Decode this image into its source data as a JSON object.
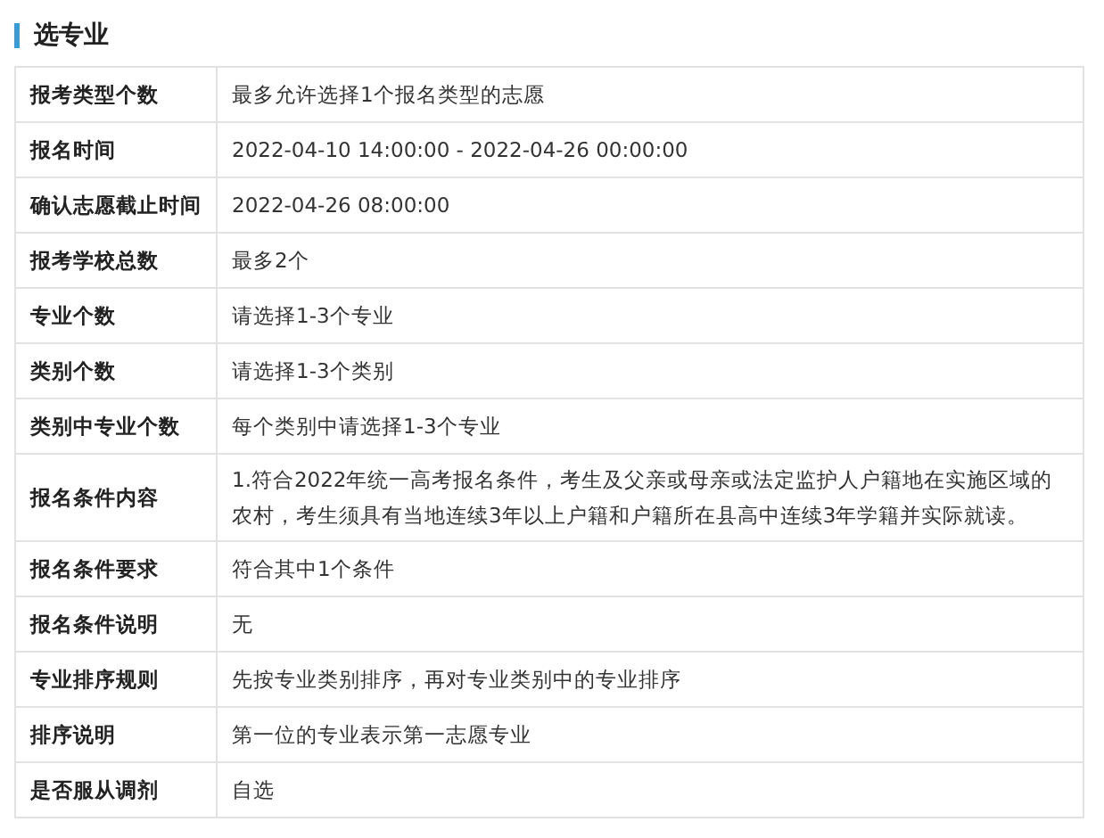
{
  "section": {
    "title": "选专业"
  },
  "rows": [
    {
      "label": "报考类型个数",
      "value": "最多允许选择1个报名类型的志愿"
    },
    {
      "label": "报名时间",
      "value": "2022-04-10 14:00:00 - 2022-04-26 00:00:00"
    },
    {
      "label": "确认志愿截止时间",
      "value": "2022-04-26 08:00:00"
    },
    {
      "label": "报考学校总数",
      "value": "最多2个"
    },
    {
      "label": "专业个数",
      "value": "请选择1-3个专业"
    },
    {
      "label": "类别个数",
      "value": "请选择1-3个类别"
    },
    {
      "label": "类别中专业个数",
      "value": "每个类别中请选择1-3个专业"
    },
    {
      "label": "报名条件内容",
      "value": "1.符合2022年统一高考报名条件，考生及父亲或母亲或法定监护人户籍地在实施区域的农村，考生须具有当地连续3年以上户籍和户籍所在县高中连续3年学籍并实际就读。"
    },
    {
      "label": "报名条件要求",
      "value": "符合其中1个条件"
    },
    {
      "label": "报名条件说明",
      "value": "无"
    },
    {
      "label": "专业排序规则",
      "value": "先按专业类别排序，再对专业类别中的专业排序"
    },
    {
      "label": "排序说明",
      "value": "第一位的专业表示第一志愿专业"
    },
    {
      "label": "是否服从调剂",
      "value": "自选"
    }
  ]
}
